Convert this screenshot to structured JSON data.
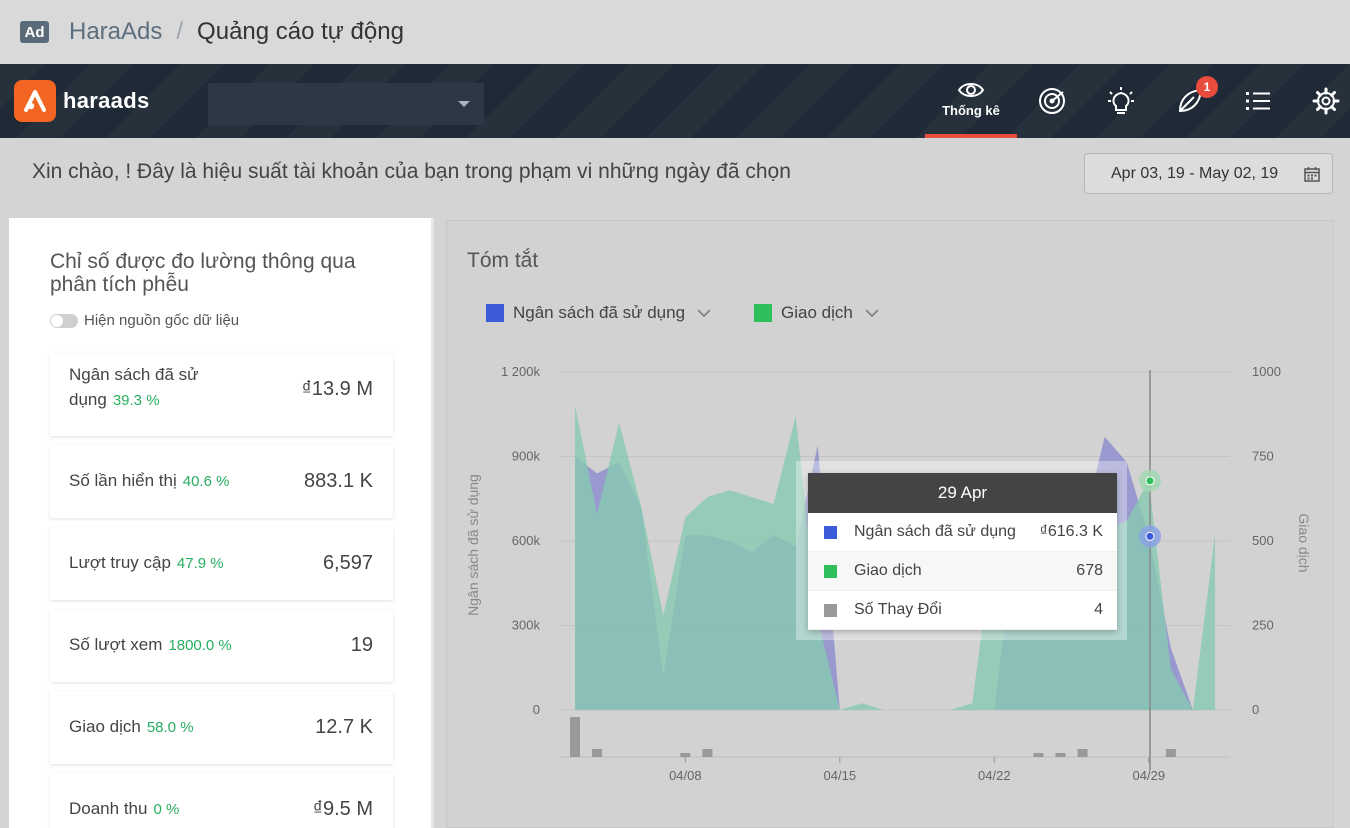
{
  "breadcrumb": {
    "badge": "Ad",
    "root": "HaraAds",
    "separator": "/",
    "current": "Quảng cáo tự động"
  },
  "nav": {
    "logo_text": "haraads",
    "active_label": "Thống kê",
    "notification_count": "1",
    "icons": [
      "eye-icon",
      "target-icon",
      "lightbulb-icon",
      "leaf-icon",
      "list-icon",
      "gear-icon"
    ],
    "accent_color": "#e74c3c"
  },
  "greeting": "Xin chào, ! Đây là hiệu suất tài khoản của bạn trong phạm vi những ngày đã chọn",
  "date_range": "Apr 03, 19 - May 02, 19",
  "left_panel": {
    "title": "Chỉ số được đo lường thông qua phân tích phễu",
    "toggle_label": "Hiện nguồn gốc dữ liệu",
    "metrics": [
      {
        "label": "Ngân sách đã sử dụng",
        "pct": "39.3 %",
        "value": "₫13.9 M"
      },
      {
        "label": "Số lần hiển thị",
        "pct": "40.6 %",
        "value": "883.1 K"
      },
      {
        "label": "Lượt truy cập",
        "pct": "47.9 %",
        "value": "6,597"
      },
      {
        "label": "Số lượt xem",
        "pct": "1800.0 %",
        "value": "19"
      },
      {
        "label": "Giao dịch",
        "pct": "58.0 %",
        "value": "12.7 K"
      },
      {
        "label": "Doanh thu",
        "pct": "0 %",
        "value": "₫9.5 M"
      }
    ]
  },
  "summary": {
    "title": "Tóm tắt",
    "legend": [
      {
        "name": "Ngân sách đã sử dụng",
        "color": "#3b5bdb"
      },
      {
        "name": "Giao dịch",
        "color": "#2fbf5a"
      }
    ]
  },
  "chart_data": {
    "type": "area",
    "x": [
      "04/03",
      "04/04",
      "04/05",
      "04/06",
      "04/07",
      "04/08",
      "04/09",
      "04/10",
      "04/11",
      "04/12",
      "04/13",
      "04/14",
      "04/15",
      "04/16",
      "04/17",
      "04/18",
      "04/19",
      "04/20",
      "04/21",
      "04/22",
      "04/23",
      "04/24",
      "04/25",
      "04/26",
      "04/27",
      "04/28",
      "04/29",
      "04/30",
      "05/01",
      "05/02"
    ],
    "x_tick_labels": [
      "04/08",
      "04/15",
      "04/22",
      "04/29"
    ],
    "series": [
      {
        "name": "Ngân sách đã sử dụng",
        "axis": "left",
        "color": "#8f8fd0",
        "values": [
          900000,
          840000,
          880000,
          720000,
          120000,
          620000,
          620000,
          600000,
          560000,
          620000,
          580000,
          940000,
          0,
          0,
          0,
          0,
          0,
          0,
          0,
          0,
          640000,
          640000,
          760000,
          640000,
          970000,
          880000,
          616300,
          220000,
          0,
          0
        ]
      },
      {
        "name": "Giao dịch",
        "axis": "right",
        "color": "#86c9b0",
        "values": [
          900,
          580,
          850,
          600,
          280,
          570,
          630,
          650,
          630,
          610,
          870,
          270,
          0,
          20,
          0,
          0,
          0,
          0,
          20,
          510,
          520,
          470,
          530,
          430,
          530,
          560,
          678,
          120,
          0,
          520
        ]
      },
      {
        "name": "Số Thay Đổi",
        "axis": "bars",
        "color": "#999999",
        "values": [
          10,
          2,
          0,
          0,
          0,
          1,
          2,
          0,
          0,
          0,
          0,
          0,
          0,
          0,
          0,
          0,
          0,
          0,
          0,
          0,
          0,
          1,
          1,
          2,
          0,
          0,
          0,
          2,
          0,
          0
        ]
      }
    ],
    "ylabel": "Ngân sách đã sử dụng",
    "y2label": "Giao dịch",
    "ylim": [
      0,
      1200000
    ],
    "y2lim": [
      0,
      1000
    ],
    "y_tick_labels": [
      "0",
      "300k",
      "600k",
      "900k",
      "1 200k"
    ],
    "y2_tick_labels": [
      "0",
      "250",
      "500",
      "750",
      "1000"
    ],
    "legend": "top-left",
    "grid": true
  },
  "tooltip": {
    "date": "29 Apr",
    "rows": [
      {
        "name": "Ngân sách đã sử dụng",
        "value": "₫616.3 K",
        "color": "#3b5bdb"
      },
      {
        "name": "Giao dịch",
        "value": "678",
        "color": "#2fbf5a"
      },
      {
        "name": "Số Thay Đổi",
        "value": "4",
        "color": "#999999"
      }
    ]
  }
}
